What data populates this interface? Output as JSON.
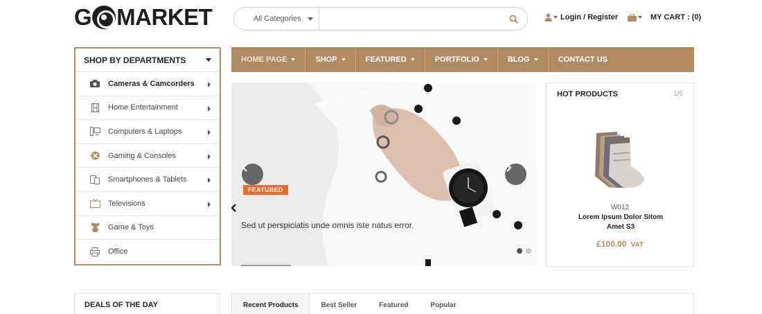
{
  "header": {
    "logo": {
      "g": "G",
      "rest": "MARKET"
    },
    "search": {
      "category": "All Categories",
      "placeholder": ""
    },
    "login_label": "Login / Register",
    "cart_label": "MY CART : (0)"
  },
  "departments": {
    "title": "SHOP BY DEPARTMENTS",
    "items": [
      {
        "label": "Cameras & Camcorders",
        "icon": "camera-icon"
      },
      {
        "label": "Home Entertainment",
        "icon": "film-icon"
      },
      {
        "label": "Computers & Laptops",
        "icon": "computer-icon"
      },
      {
        "label": "Gaming & Consoles",
        "icon": "gamepad-icon"
      },
      {
        "label": "Smartphones & Tablets",
        "icon": "phone-icon"
      },
      {
        "label": "Televisions",
        "icon": "tv-icon"
      },
      {
        "label": "Game & Toys",
        "icon": "teddy-bear-icon"
      },
      {
        "label": "Office",
        "icon": "printer-icon"
      }
    ]
  },
  "nav": {
    "items": [
      {
        "label": "HOME PAGE"
      },
      {
        "label": "SHOP"
      },
      {
        "label": "FEATURED"
      },
      {
        "label": "PORTFOLIO"
      },
      {
        "label": "BLOG"
      },
      {
        "label": "CONTACT US"
      }
    ]
  },
  "hero": {
    "badge": "FEATURED",
    "caption": "Sed ut perspiciatis unde omnis iste natus error."
  },
  "hot_products": {
    "title": "HOT PRODUCTS",
    "page": "1/5",
    "code": "W012",
    "name": "Lorem Ipsum Dolor Sitom Amet S3",
    "price": "£100.00",
    "vat": "VAT"
  },
  "deals": {
    "title": "DEALS OF THE DAY"
  },
  "tabs": [
    {
      "label": "Recent Products"
    },
    {
      "label": "Best Seller"
    },
    {
      "label": "Featured"
    },
    {
      "label": "Popular"
    }
  ],
  "colors": {
    "accent": "#b08b61",
    "badge": "#ef6a26"
  }
}
